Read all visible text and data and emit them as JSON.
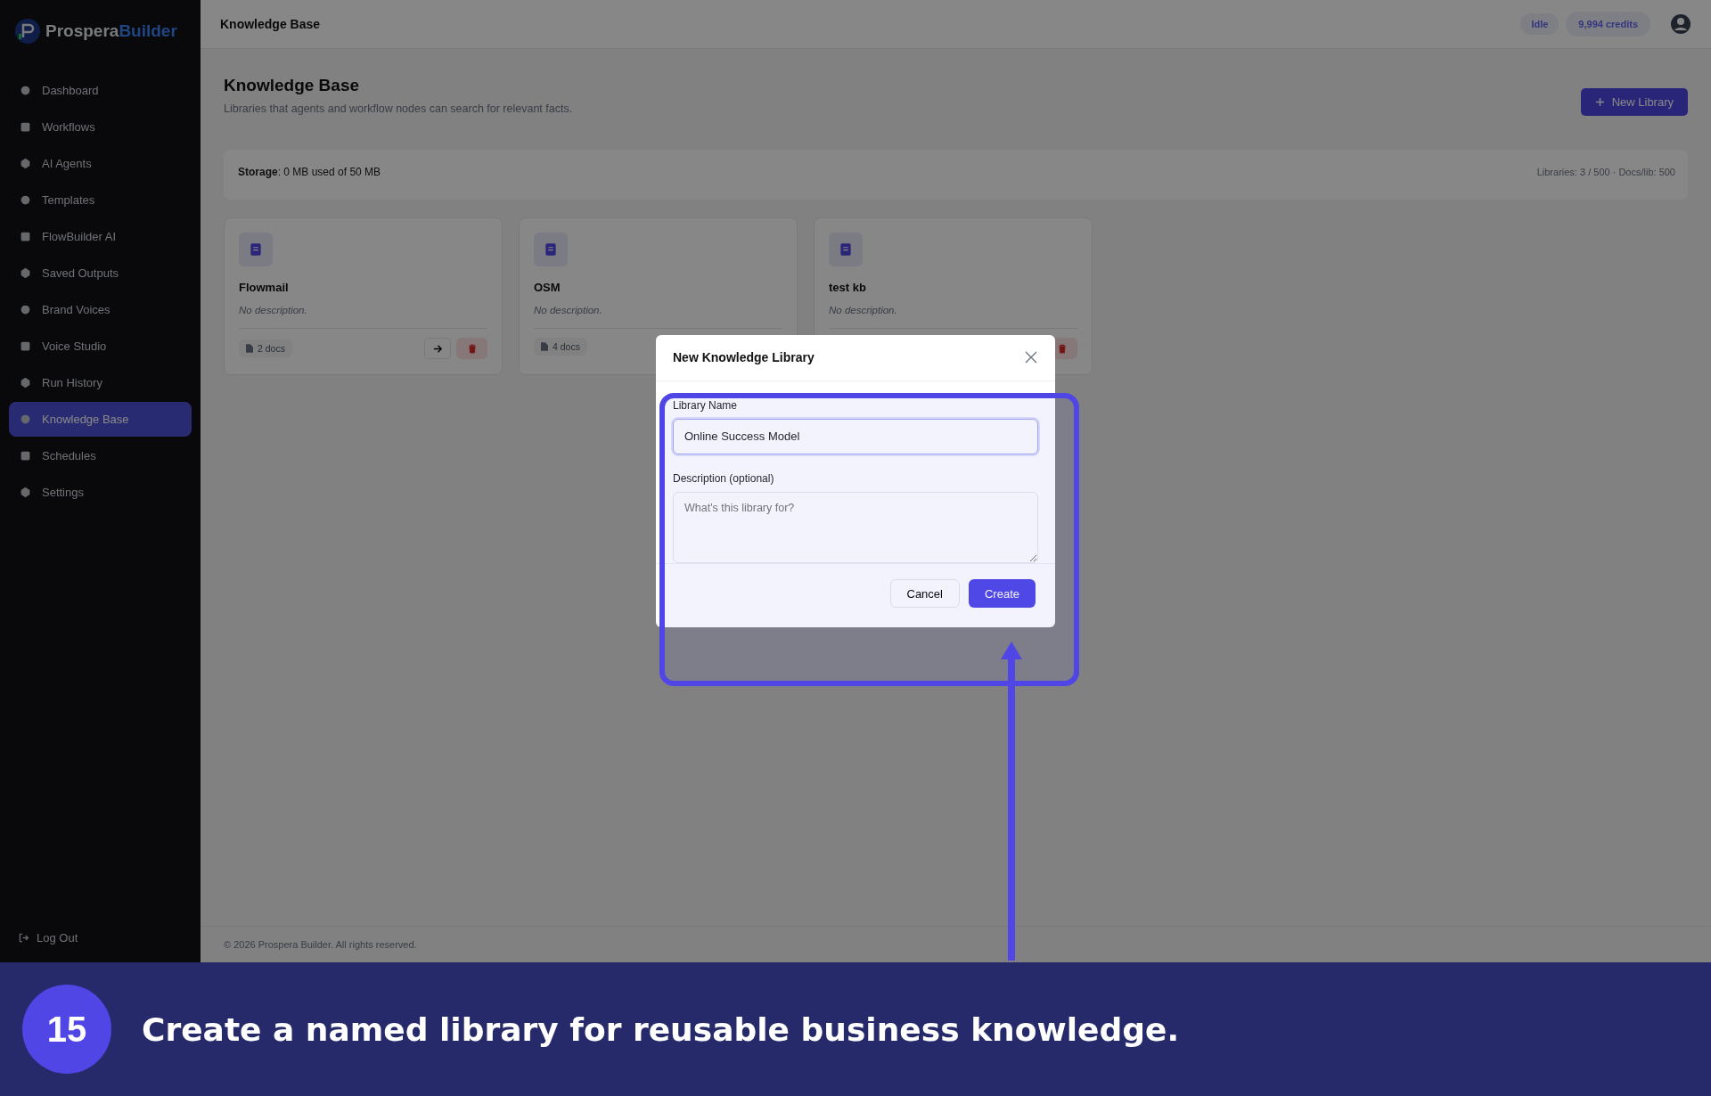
{
  "brand": {
    "name_part_1": "Prospera",
    "name_part_2": "Builder"
  },
  "sidebar": {
    "items": [
      {
        "label": "Dashboard",
        "selected": false
      },
      {
        "label": "Workflows",
        "selected": false
      },
      {
        "label": "AI Agents",
        "selected": false
      },
      {
        "label": "Templates",
        "selected": false
      },
      {
        "label": "FlowBuilder AI",
        "selected": false
      },
      {
        "label": "Saved Outputs",
        "selected": false
      },
      {
        "label": "Brand Voices",
        "selected": false
      },
      {
        "label": "Voice Studio",
        "selected": false
      },
      {
        "label": "Run History",
        "selected": false
      },
      {
        "label": "Knowledge Base",
        "selected": true
      },
      {
        "label": "Schedules",
        "selected": false
      },
      {
        "label": "Settings",
        "selected": false
      }
    ],
    "logout": "Log Out"
  },
  "topbar": {
    "title": "Knowledge Base",
    "status": "Idle",
    "credits": "9,994 credits"
  },
  "page": {
    "title": "Knowledge Base",
    "subtitle": "Libraries that agents and workflow nodes can search for relevant facts.",
    "new_button": "New Library"
  },
  "storage": {
    "text": "**Storage**: 0 MB used of 50 MB",
    "limits": "Libraries: 3 / 500 · Docs/lib: 500"
  },
  "libraries": [
    {
      "name": "Flowmail",
      "description": "No description.",
      "docs": "2 docs"
    },
    {
      "name": "OSM",
      "description": "No description.",
      "docs": "4 docs"
    },
    {
      "name": "test kb",
      "description": "No description."
    }
  ],
  "footer": "© 2026 Prospera Builder. All rights reserved.",
  "dialog": {
    "title": "New Knowledge Library",
    "name_label": "Library Name",
    "name_value": "Online Success Model",
    "description_label": "Description (optional)",
    "description_placeholder": "What's this library for?",
    "cancel": "Cancel",
    "create": "Create"
  },
  "caption": {
    "step": "15",
    "text": "Create a named library for reusable business knowledge."
  }
}
